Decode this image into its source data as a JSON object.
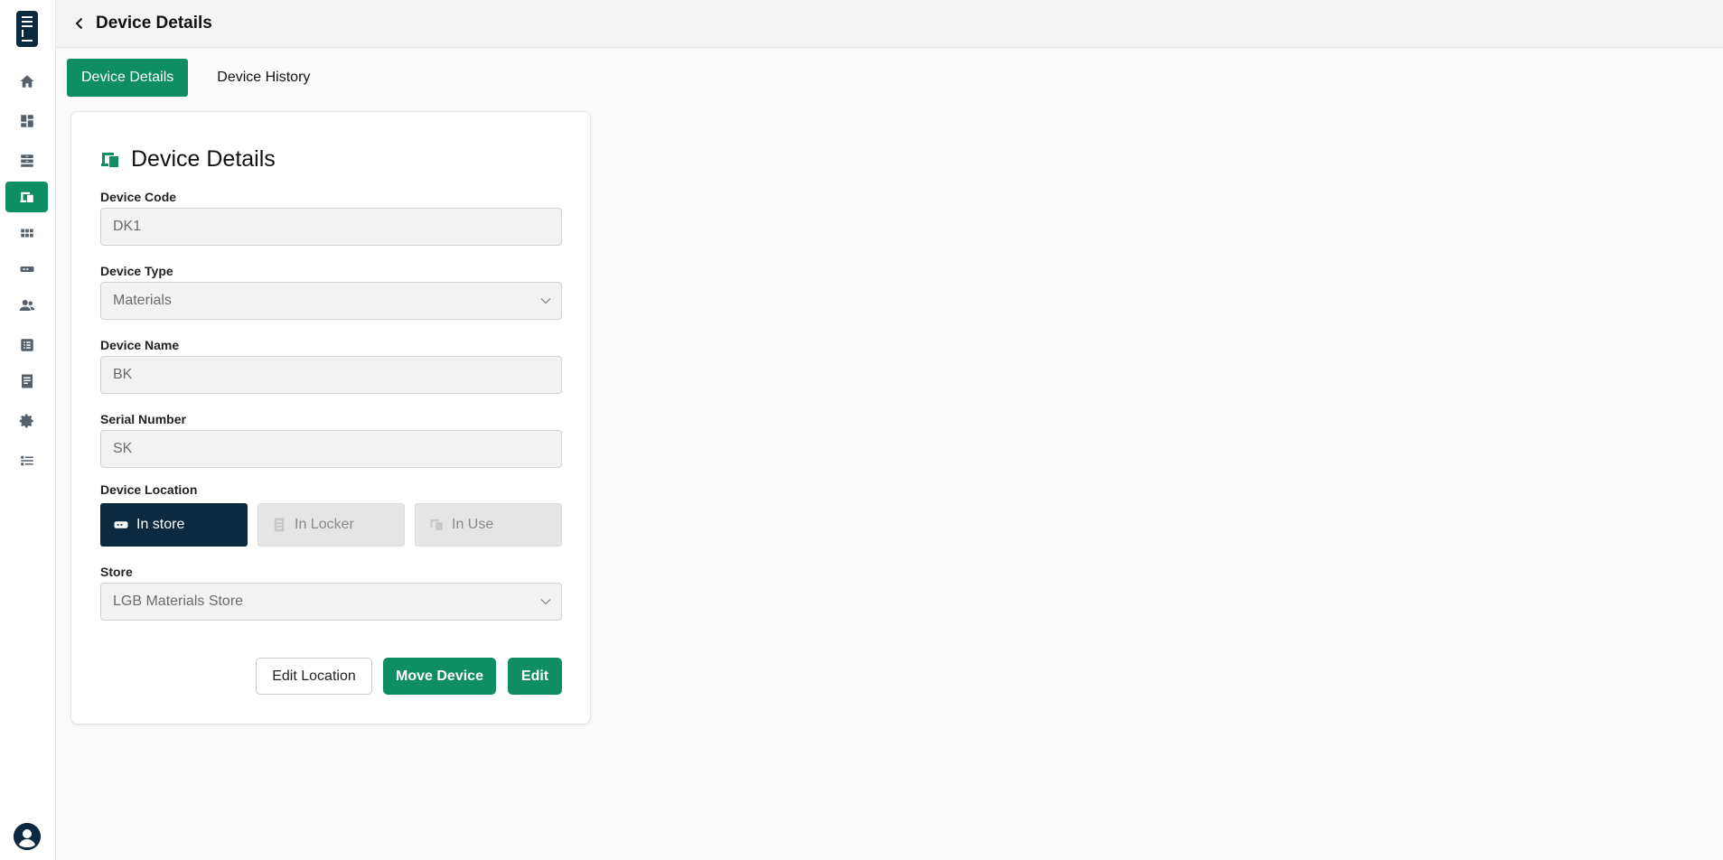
{
  "app": {
    "brand_color": "#0f8e64",
    "dark_color": "#0b2a3f"
  },
  "sidebar": {
    "logo_icon": "app-logo",
    "items": [
      {
        "icon": "home-icon"
      },
      {
        "icon": "dashboard-icon"
      },
      {
        "icon": "locker-icon"
      },
      {
        "icon": "devices-icon",
        "active": true
      },
      {
        "icon": "grid-icon"
      },
      {
        "icon": "store-icon"
      },
      {
        "icon": "users-icon"
      },
      {
        "icon": "list-icon"
      },
      {
        "icon": "report-icon"
      },
      {
        "icon": "settings-icon"
      },
      {
        "icon": "checklist-icon"
      }
    ],
    "avatar_icon": "user-avatar-icon"
  },
  "header": {
    "title": "Device Details"
  },
  "tabs": [
    {
      "label": "Device Details",
      "active": true
    },
    {
      "label": "Device History",
      "active": false
    }
  ],
  "card": {
    "title": "Device Details",
    "fields": {
      "device_code": {
        "label": "Device Code",
        "value": "DK1"
      },
      "device_type": {
        "label": "Device Type",
        "value": "Materials"
      },
      "device_name": {
        "label": "Device Name",
        "value": "BK"
      },
      "serial_number": {
        "label": "Serial Number",
        "value": "SK"
      },
      "store": {
        "label": "Store",
        "value": "LGB Materials Store"
      }
    },
    "location": {
      "label": "Device Location",
      "options": [
        {
          "label": "In store",
          "selected": true
        },
        {
          "label": "In Locker",
          "selected": false
        },
        {
          "label": "In Use",
          "selected": false
        }
      ]
    },
    "actions": {
      "edit_location": "Edit Location",
      "move_device": "Move Device",
      "edit": "Edit"
    }
  }
}
